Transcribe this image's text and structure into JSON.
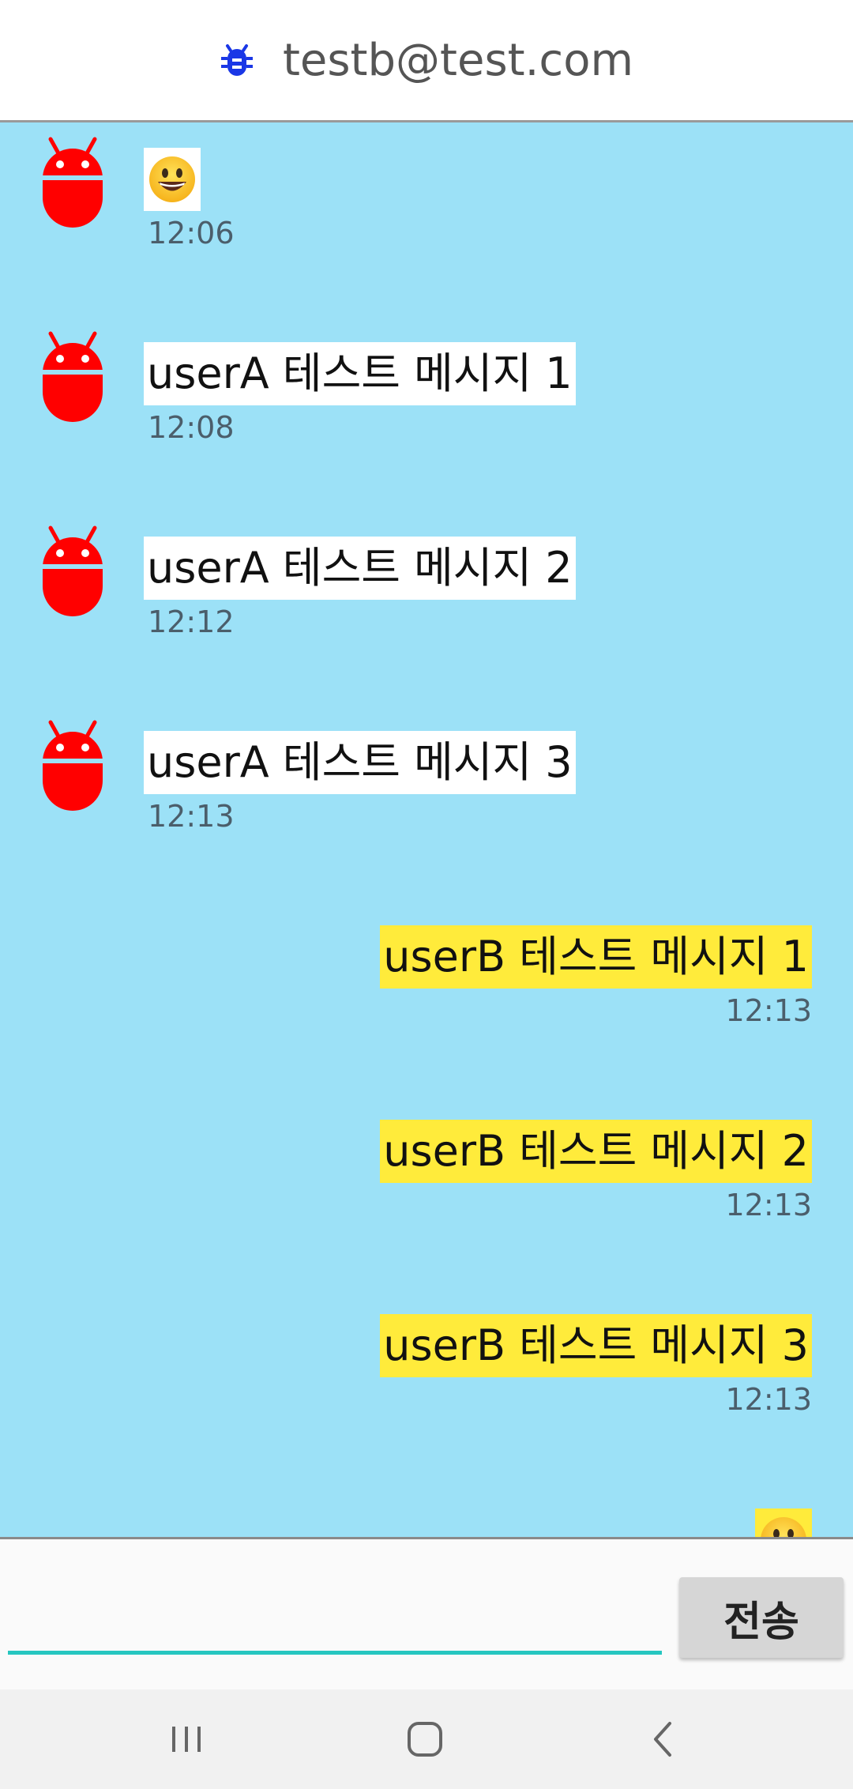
{
  "header": {
    "title": "testb@test.com",
    "icon": "bug-icon",
    "icon_color": "#1a37e6"
  },
  "colors": {
    "chat_background": "#9ce1f7",
    "other_bubble": "#ffffff",
    "my_bubble": "#ffeb3b",
    "avatar": "#ff0000",
    "input_underline": "#26c6c0"
  },
  "messages_received": [
    {
      "sender_icon": "android-icon",
      "content": "😀",
      "is_emoji": true,
      "time": "12:06"
    },
    {
      "sender_icon": "android-icon",
      "content": "userA 테스트 메시지 1",
      "time": "12:08"
    },
    {
      "sender_icon": "android-icon",
      "content": "userA 테스트 메시지 2",
      "time": "12:12"
    },
    {
      "sender_icon": "android-icon",
      "content": "userA 테스트 메시지 3",
      "time": "12:13"
    }
  ],
  "messages_sent": [
    {
      "content": "userB 테스트 메시지 1",
      "time": "12:13"
    },
    {
      "content": "userB 테스트 메시지 2",
      "time": "12:13"
    },
    {
      "content": "userB 테스트 메시지 3",
      "time": "12:13"
    },
    {
      "content": "😀",
      "is_emoji": true
    }
  ],
  "composer": {
    "value": "",
    "placeholder": "",
    "send_label": "전송"
  },
  "navbar": {
    "recent_icon": "recent-apps-icon",
    "home_icon": "home-icon",
    "back_icon": "back-icon"
  }
}
